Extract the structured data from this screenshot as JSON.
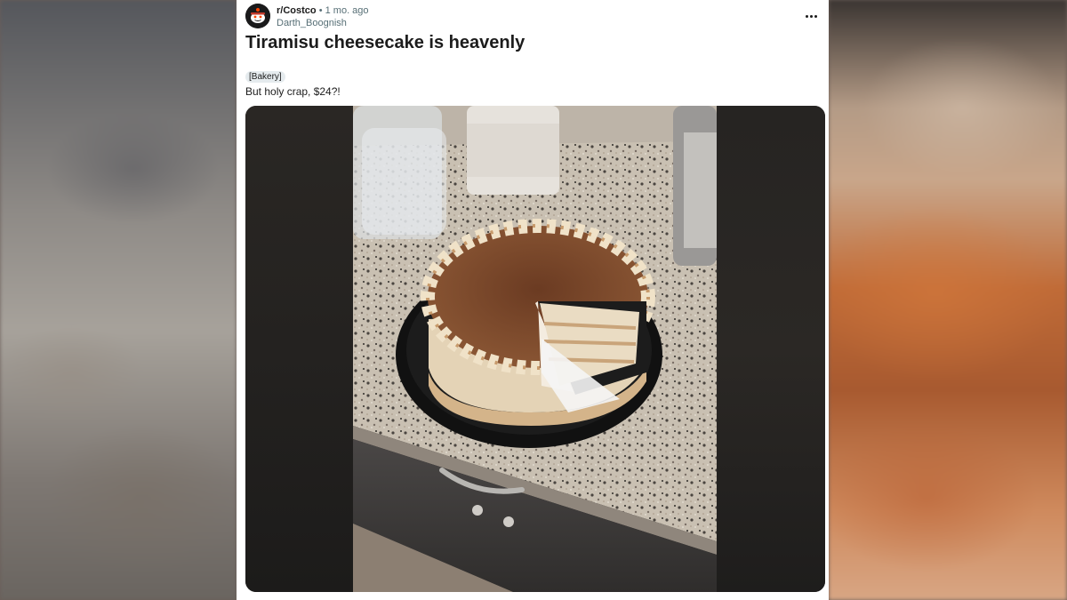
{
  "post": {
    "subreddit": "r/Costco",
    "separator": "•",
    "time_ago": "1 mo. ago",
    "username": "Darth_Boognish",
    "title": "Tiramisu cheesecake is heavenly",
    "flair": "[Bakery]",
    "body": "But holy crap, $24?!"
  },
  "icons": {
    "avatar": "snoo-avatar-icon",
    "more": "more-options-icon"
  },
  "colors": {
    "text": "#1c1c1c",
    "meta": "#576f76",
    "flair_bg": "#e5ebee"
  }
}
